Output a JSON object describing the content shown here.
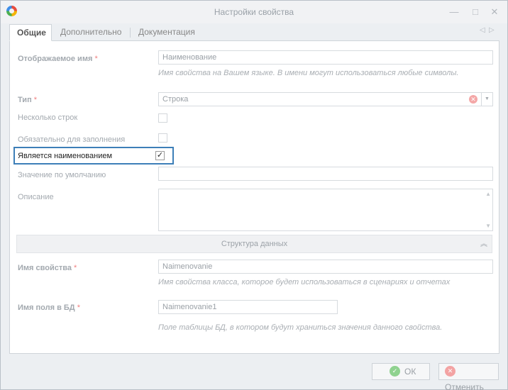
{
  "window": {
    "title": "Настройки свойства",
    "controls": {
      "minimize": "—",
      "maximize": "□",
      "close": "✕"
    }
  },
  "tabs": [
    {
      "label": "Общие",
      "active": true
    },
    {
      "label": "Дополнительно",
      "active": false
    },
    {
      "label": "Документация",
      "active": false
    }
  ],
  "form": {
    "display_name": {
      "label": "Отображаемое имя",
      "required_mark": "*",
      "value": "Наименование",
      "hint": "Имя свойства на Вашем языке. В имени могут использоваться любые символы."
    },
    "type": {
      "label": "Тип",
      "required_mark": "*",
      "value": "Строка"
    },
    "multiline": {
      "label": "Несколько строк",
      "checked": false
    },
    "required": {
      "label": "Обязательно для заполнения",
      "checked": false
    },
    "is_name": {
      "label": "Является наименованием",
      "checked": true,
      "check_glyph": "✓"
    },
    "default_value": {
      "label": "Значение по умолчанию",
      "value": ""
    },
    "description": {
      "label": "Описание",
      "value": ""
    },
    "data_section": {
      "title": "Структура данных",
      "collapse_glyph": "︽"
    },
    "property_name": {
      "label": "Имя свойства",
      "required_mark": "*",
      "value": "Naimenovanie",
      "hint": "Имя свойства класса, которое будет использоваться в сценариях и отчетах"
    },
    "db_field": {
      "label": "Имя поля в БД",
      "required_mark": "*",
      "value": "Naimenovanie1",
      "hint": "Поле таблицы БД, в котором будут храниться значения данного свойства."
    }
  },
  "footer": {
    "ok_label": "ОК",
    "cancel_label": "Отменить"
  },
  "colors": {
    "accent_highlight": "#3d7fb8",
    "ok_icon": "#8fd28f",
    "cancel_icon": "#f3a3a3",
    "required_mark": "#f08080"
  }
}
